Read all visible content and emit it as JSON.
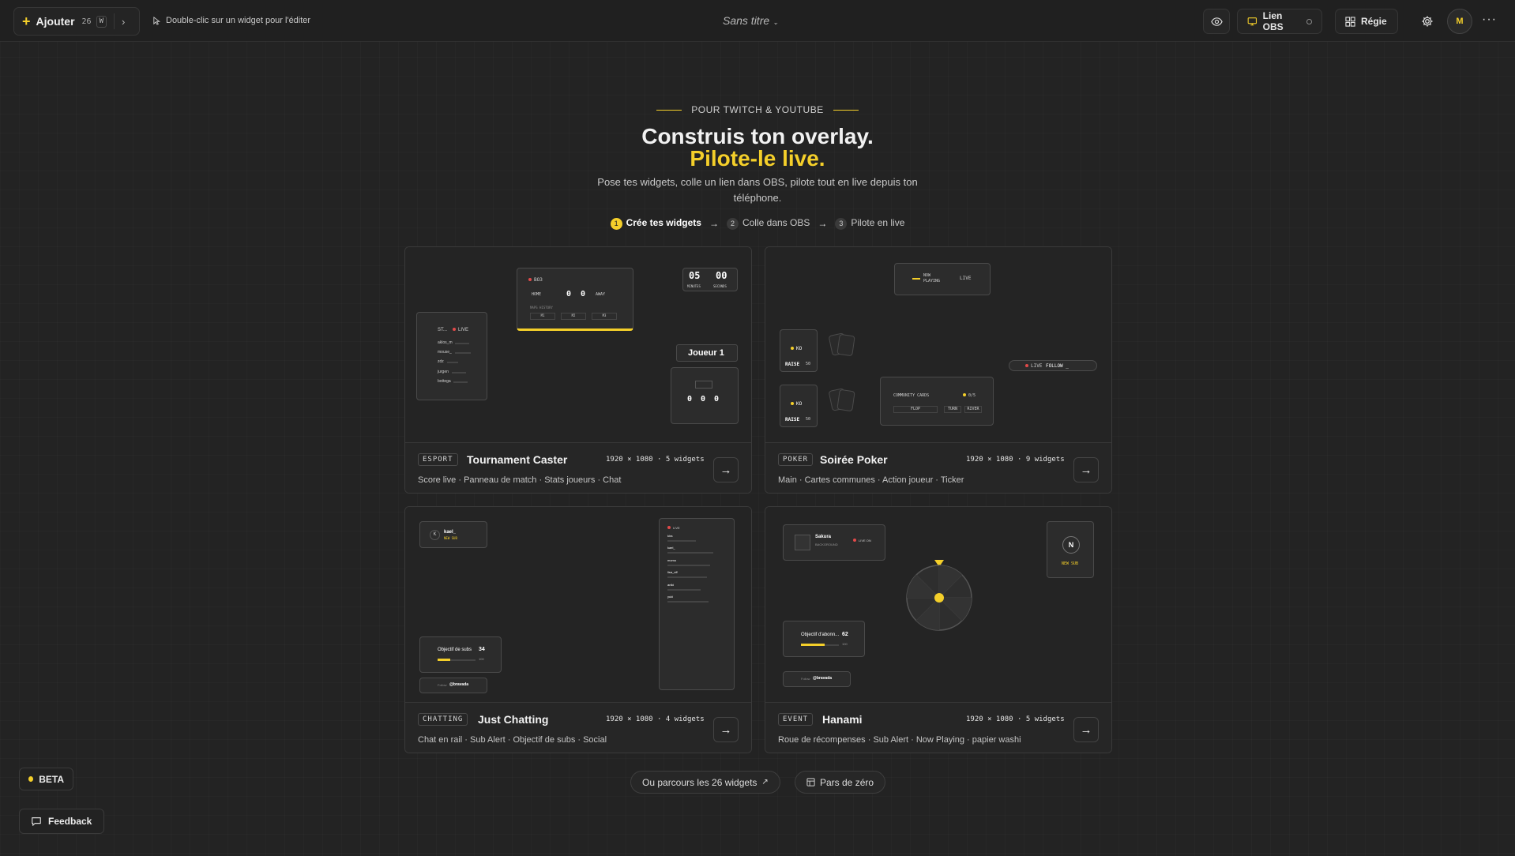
{
  "toolbar": {
    "add_label": "Ajouter",
    "widget_count": "26",
    "kbd_hint": "W",
    "edit_hint": "Double-clic sur un widget pour l'éditer",
    "doc_title": "Sans titre",
    "obs_label": "Lien OBS",
    "regie_label": "Régie",
    "avatar_initial": "M"
  },
  "hero": {
    "eyebrow": "POUR TWITCH & YOUTUBE",
    "title_line1": "Construis ton overlay.",
    "title_line2": "Pilote-le live.",
    "subtitle": "Pose tes widgets, colle un lien dans OBS, pilote tout en live depuis ton téléphone.",
    "steps": [
      {
        "num": "1",
        "label": "Crée tes widgets"
      },
      {
        "num": "2",
        "label": "Colle dans OBS"
      },
      {
        "num": "3",
        "label": "Pilote en live"
      }
    ]
  },
  "templates": [
    {
      "tag": "ESPORT",
      "name": "Tournament Caster",
      "meta": "1920 × 1080 · 5 widgets",
      "desc": "Score live · Panneau de match · Stats joueurs · Chat"
    },
    {
      "tag": "POKER",
      "name": "Soirée Poker",
      "meta": "1920 × 1080 · 9 widgets",
      "desc": "Main · Cartes communes · Action joueur · Ticker"
    },
    {
      "tag": "CHATTING",
      "name": "Just Chatting",
      "meta": "1920 × 1080 · 4 widgets",
      "desc": "Chat en rail · Sub Alert · Objectif de subs · Social"
    },
    {
      "tag": "EVENT",
      "name": "Hanami",
      "meta": "1920 × 1080 · 5 widgets",
      "desc": "Roue de récompenses · Sub Alert · Now Playing · papier washi"
    }
  ],
  "previews": {
    "esport": {
      "bo3": "BO3",
      "home": "HOME",
      "away": "AWAY",
      "score_home": "0",
      "score_away": "0",
      "map_history": "MAPS HISTORY",
      "maps": [
        "M1",
        "M2",
        "M3"
      ],
      "timer_min": "05",
      "timer_sec": "00",
      "min_lbl": "MINUTES",
      "sec_lbl": "SECONDS",
      "player": "Joueur 1",
      "stats": [
        "0",
        "0",
        "0"
      ],
      "chat_head": "ST...",
      "chat_live": "LIVE",
      "chat_users": [
        "aklos_m",
        "mouse_",
        "zdz",
        "jurgen",
        "bottega"
      ]
    },
    "poker": {
      "now_playing": "NOW PLAYING",
      "live": "LIVE",
      "ko": "KO",
      "raise": "RAISE",
      "raise_val": "50",
      "follow_live": "LIVE",
      "follow": "FOLLOW _",
      "community": "COMMUNITY CARDS",
      "comm_count": "0/5",
      "flop": "FLOP",
      "turn": "TURN",
      "river": "RIVER"
    },
    "chatting": {
      "sub_user": "kael_",
      "sub_label": "NEW SUB",
      "sub_initial": "K",
      "goal_label": "Objectif de subs",
      "goal_val": "34",
      "goal_max": "100",
      "social_handle": "@bravada",
      "social_pre": "Follow",
      "rail_live": "LIVE",
      "rail_users": [
        "kira",
        "kael_",
        "momo",
        "lisa_off",
        "aniki",
        "yuki"
      ]
    },
    "hanami": {
      "np_title": "Sakura",
      "np_artist": "BACKGROUND",
      "np_live": "LIVE ON",
      "sub_initial": "N",
      "sub_label": "NEW SUB",
      "goal_label": "Objectif d'abonn...",
      "goal_val": "62",
      "goal_max": "100",
      "social_handle": "@bravada",
      "social_pre": "Follow"
    }
  },
  "footer": {
    "browse": "Ou parcours les 26 widgets",
    "scratch": "Pars de zéro",
    "beta": "BETA",
    "feedback": "Feedback"
  }
}
